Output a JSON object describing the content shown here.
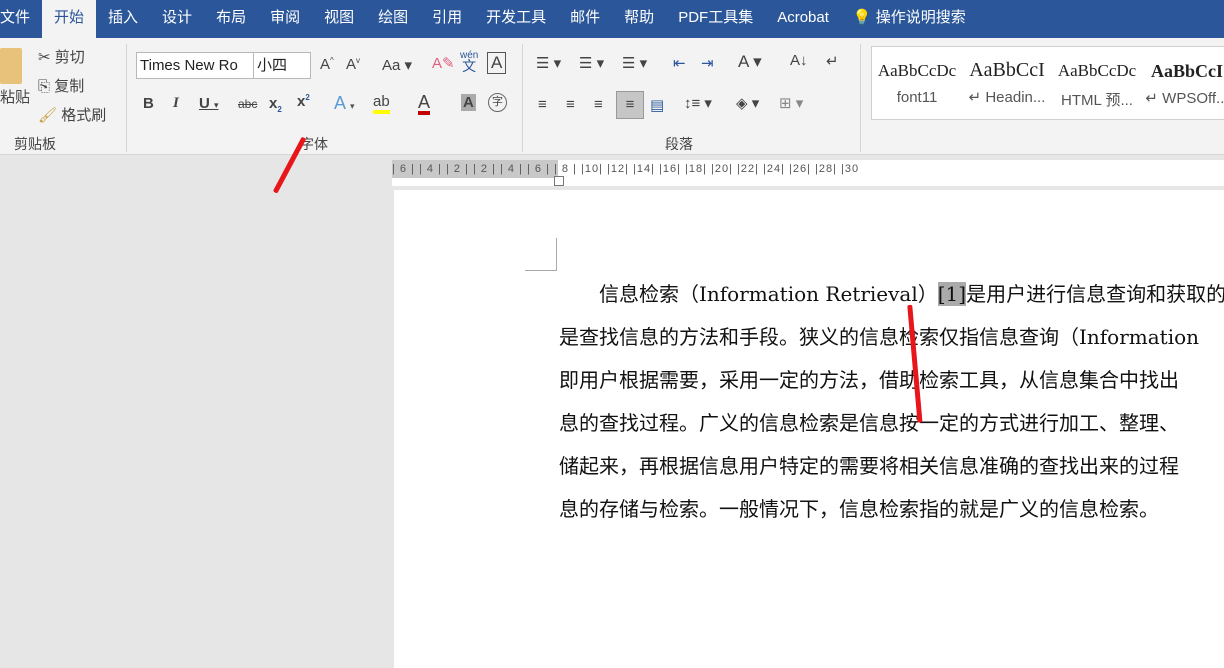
{
  "tabs": [
    "文件",
    "开始",
    "插入",
    "设计",
    "布局",
    "审阅",
    "视图",
    "绘图",
    "引用",
    "开发工具",
    "邮件",
    "帮助",
    "PDF工具集",
    "Acrobat"
  ],
  "tell_me": "操作说明搜索",
  "clipboard": {
    "paste": "粘贴",
    "cut": "剪切",
    "copy": "复制",
    "format_painter": "格式刷",
    "label": "剪贴板"
  },
  "font": {
    "name": "Times New Ro",
    "size": "小四",
    "label": "字体",
    "wen": "wén",
    "wen_char": "文"
  },
  "paragraph": {
    "label": "段落"
  },
  "styles": [
    {
      "preview": "AaBbCcDc",
      "name": "font11"
    },
    {
      "preview": "AaBbCcI",
      "name": "↵ Headin..."
    },
    {
      "preview": "AaBbCcDc",
      "name": "HTML 预..."
    },
    {
      "preview": "AaBbCcI",
      "name": "↵ WPSOff..."
    }
  ],
  "ruler": "| 6 |  | 4 |  | 2 |    |  2 |   | 4 |   | 6 |   | 8 |   |10|   |12|   |14|   |16|   |18|   |20|   |22|   |24|   |26|   |28|   |30",
  "document": {
    "line1_pre": "信息检索（Information Retrieval）",
    "line1_ref": "[1]",
    "line1_post": "是用户进行信息查询和获取的主",
    "lines": [
      "是查找信息的方法和手段。狭义的信息检索仅指信息查询（Information",
      "即用户根据需要，采用一定的方法，借助检索工具，从信息集合中找出",
      "息的查找过程。广义的信息检索是信息按一定的方式进行加工、整理、",
      "储起来，再根据信息用户特定的需要将相关信息准确的查找出来的过程",
      "息的存储与检索。一般情况下，信息检索指的就是广义的信息检索。"
    ]
  }
}
